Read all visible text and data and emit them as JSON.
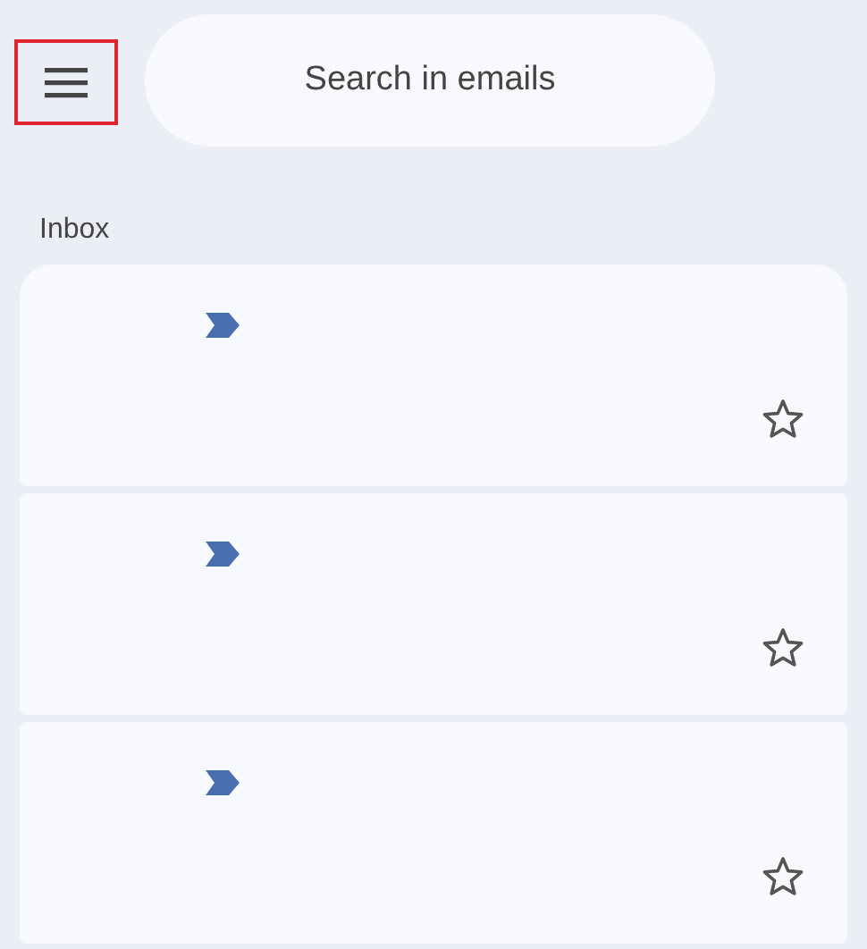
{
  "menu_button": {
    "highlighted": true
  },
  "search": {
    "placeholder": "Search in emails"
  },
  "section_title": "Inbox",
  "emails": [
    {
      "important": true,
      "starred": false
    },
    {
      "important": true,
      "starred": false
    },
    {
      "important": true,
      "starred": false
    }
  ]
}
